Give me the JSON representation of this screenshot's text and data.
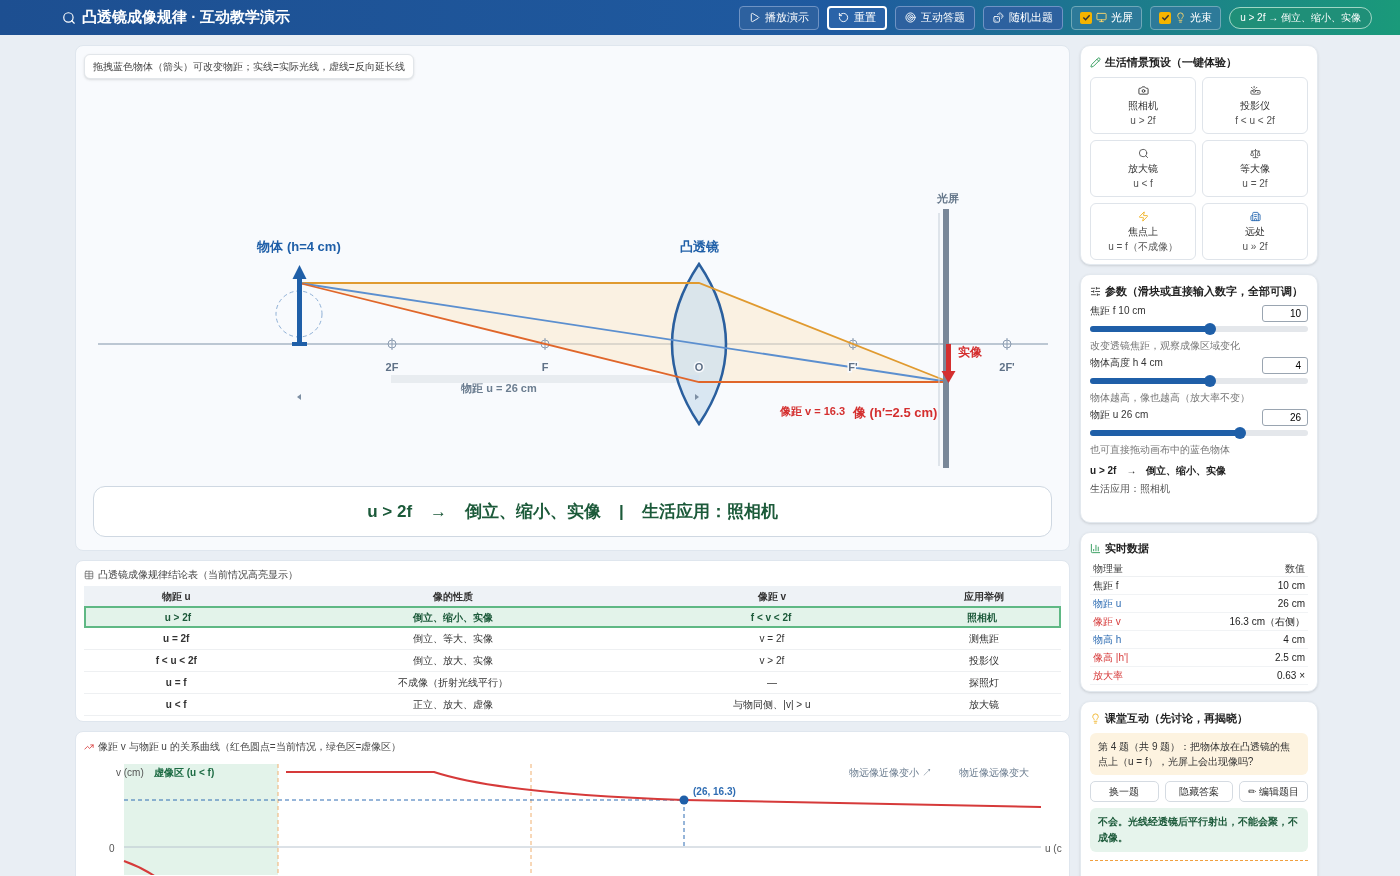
{
  "header": {
    "title": "凸透镜成像规律 · 互动教学演示",
    "buttons": [
      {
        "label": "播放演示",
        "selected": false
      },
      {
        "label": "重置",
        "selected": true
      },
      {
        "label": "互动答题",
        "selected": false
      },
      {
        "label": "随机出题",
        "selected": false
      }
    ],
    "toggles": [
      {
        "label": "光屏",
        "checked": true
      },
      {
        "label": "光束",
        "checked": true
      }
    ],
    "status": "u > 2f → 倒立、缩小、实像"
  },
  "diagram": {
    "hint": "拖拽蓝色物体（箭头）可改变物距；实线=实际光线，虚线=反向延长线",
    "object_label": "物体 (h=4 cm)",
    "lens_label": "凸透镜",
    "screen_label": "光屏",
    "image_label": "实像",
    "points": [
      "2F",
      "F",
      "O",
      "F'",
      "2F'"
    ],
    "object_distance": "物距 u = 26 cm",
    "image_distance": "像距 v = 16.3",
    "image_height": "像 (h′=2.5 cm)",
    "banner": {
      "rule": "u > 2f",
      "arrow": "→",
      "result": "倒立、缩小、实像",
      "sep": "|",
      "application": "生活应用：照相机"
    }
  },
  "table": {
    "title": "凸透镜成像规律结论表（当前情况高亮显示）",
    "columns": [
      "物距 u",
      "像的性质",
      "像距 v",
      "应用举例"
    ],
    "rows": [
      {
        "cells": [
          "u > 2f",
          "倒立、缩小、实像",
          "f < v < 2f",
          "照相机"
        ],
        "selected": true
      },
      {
        "cells": [
          "u = 2f",
          "倒立、等大、实像",
          "v = 2f",
          "测焦距"
        ],
        "selected": false
      },
      {
        "cells": [
          "f < u < 2f",
          "倒立、放大、实像",
          "v > 2f",
          "投影仪"
        ],
        "selected": false
      },
      {
        "cells": [
          "u = f",
          "不成像（折射光线平行）",
          "—",
          "探照灯"
        ],
        "selected": false
      },
      {
        "cells": [
          "u < f",
          "正立、放大、虚像",
          "与物同侧、|v| > u",
          "放大镜"
        ],
        "selected": false
      }
    ]
  },
  "curve": {
    "title": "像距 v 与物距 u 的关系曲线（红色圆点=当前情况，绿色区=虚像区）",
    "ylabel": "v (cm)",
    "zone": "虚像区 (u < f)",
    "note_far": "物远像近像变小 ↗",
    "note_near": "物近像远像变大",
    "point": "(26, 16.3)",
    "zero": "0",
    "xlabel": "u (c"
  },
  "presets": {
    "title": "生活情景预设（一键体验）",
    "items": [
      {
        "label": "照相机",
        "cond": "u > 2f"
      },
      {
        "label": "投影仪",
        "cond": "f < u < 2f"
      },
      {
        "label": "放大镜",
        "cond": "u < f"
      },
      {
        "label": "等大像",
        "cond": "u = 2f"
      },
      {
        "label": "焦点上",
        "cond": "u = f（不成像）"
      },
      {
        "label": "远处",
        "cond": "u » 2f"
      }
    ]
  },
  "params": {
    "title": "参数（滑块或直接输入数字，全部可调）",
    "sliders": [
      {
        "label": "焦距 f 10 cm",
        "value": "10",
        "level": 0.55,
        "hint": "改变透镜焦距，观察成像区域变化"
      },
      {
        "label": "物体高度 h 4 cm",
        "value": "4",
        "level": 0.55,
        "hint": "物体越高，像也越高（放大率不变）"
      },
      {
        "label": "物距 u 26 cm",
        "value": "26",
        "level": 0.69,
        "hint": "也可直接拖动画布中的蓝色物体"
      }
    ],
    "result": "u > 2f　→　倒立、缩小、实像",
    "application": "生活应用：照相机"
  },
  "realtime": {
    "title": "实时数据",
    "columns": [
      "物理量",
      "数值"
    ],
    "rows": [
      {
        "name": "焦距 f",
        "value": "10 cm",
        "kind": "lens"
      },
      {
        "name": "物距 u",
        "value": "26 cm",
        "kind": "object"
      },
      {
        "name": "像距 v",
        "value": "16.3 cm（右侧）",
        "kind": "image"
      },
      {
        "name": "物高 h",
        "value": "4 cm",
        "kind": "object"
      },
      {
        "name": "像高 |h'|",
        "value": "2.5 cm",
        "kind": "image"
      },
      {
        "name": "放大率",
        "value": "0.63 ×",
        "kind": "image"
      }
    ]
  },
  "quiz": {
    "title": "课堂互动（先讨论，再揭晓）",
    "question": "第 4 题（共 9 题）：把物体放在凸透镜的焦点上（u = f），光屏上会出现像吗?",
    "buttons": [
      "换一题",
      "隐藏答案",
      "✏ 编辑题目"
    ],
    "answer": "不会。光线经透镜后平行射出，不能会聚，不成像。"
  }
}
